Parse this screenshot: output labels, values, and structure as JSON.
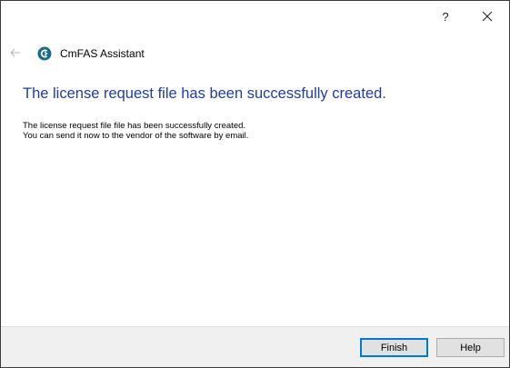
{
  "titlebar": {
    "help_label": "?",
    "close_icon": "close-icon"
  },
  "nav": {
    "back_icon": "back-arrow-icon",
    "logo_icon": "cmfas-logo-icon",
    "app_title": "CmFAS Assistant"
  },
  "content": {
    "heading": "The license request file has been successfully created.",
    "body_lines": [
      "The license request file file has been successfully created.",
      "You can send it now to the vendor of the software by email."
    ]
  },
  "footer": {
    "finish_label": "Finish",
    "help_label": "Help"
  },
  "colors": {
    "heading": "#1e3ea0",
    "logo": "#1a6a8a",
    "default_button_border": "#0078d7",
    "footer_background": "#f0f0f0"
  }
}
